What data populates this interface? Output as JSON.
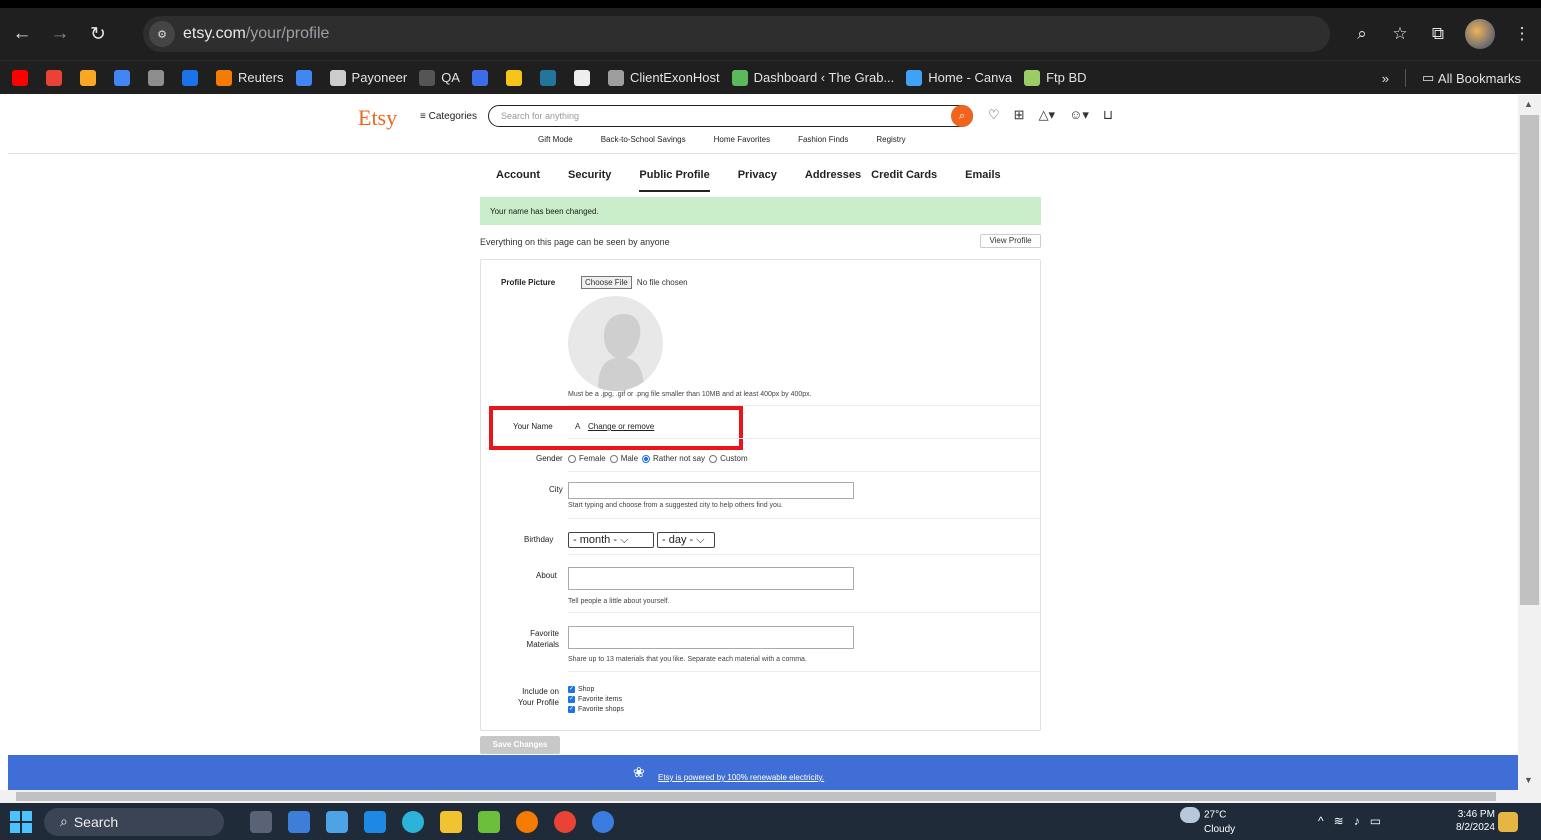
{
  "browser": {
    "url_host": "etsy.com",
    "url_path": "/your/profile",
    "bookmarks": [
      {
        "label": "",
        "color": "#ff0000"
      },
      {
        "label": "",
        "color": "#ea4335"
      },
      {
        "label": "",
        "color": "#f9a825"
      },
      {
        "label": "",
        "color": "#4285f4"
      },
      {
        "label": "",
        "color": "#8e8e8e"
      },
      {
        "label": "",
        "color": "#1a73e8"
      },
      {
        "label": "Reuters",
        "color": "#f57c00"
      },
      {
        "label": "",
        "color": "#4285f4"
      },
      {
        "label": "Payoneer",
        "color": "#cccccc"
      },
      {
        "label": "QA",
        "color": "#555555"
      },
      {
        "label": "",
        "color": "#3d6ce8"
      },
      {
        "label": "",
        "color": "#f5c518"
      },
      {
        "label": "",
        "color": "#21759b"
      },
      {
        "label": "",
        "color": "#eeeeee"
      },
      {
        "label": "ClientExonHost",
        "color": "#9e9e9e"
      },
      {
        "label": "Dashboard ‹ The Grab...",
        "color": "#5cb85c"
      },
      {
        "label": "Home - Canva",
        "color": "#3fa2f7"
      },
      {
        "label": "Ftp BD",
        "color": "#9ccc65"
      }
    ],
    "all_bookmarks": "All Bookmarks",
    "overflow": "»"
  },
  "etsy": {
    "logo": "Etsy",
    "categories": "≡ Categories",
    "search_placeholder": "Search for anything",
    "subnav": [
      "Gift Mode",
      "Back-to-School Savings",
      "Home Favorites",
      "Fashion Finds",
      "Registry"
    ],
    "tabs": [
      "Account",
      "Security",
      "Public Profile",
      "Privacy",
      "Addresses",
      "Credit Cards",
      "Emails"
    ],
    "active_tab": "Public Profile",
    "alert": "Your name has been changed.",
    "visible_note": "Everything on this page can be seen by anyone",
    "view_profile": "View Profile",
    "form": {
      "profile_picture_label": "Profile Picture",
      "choose_file_btn": "Choose File",
      "no_file": "No file chosen",
      "picture_hint": "Must be a .jpg, .gif or .png file smaller than 10MB and at least 400px by 400px.",
      "your_name_label": "Your Name",
      "your_name_value": "A",
      "change_link": "Change or remove",
      "gender_label": "Gender",
      "gender_options": [
        "Female",
        "Male",
        "Rather not say",
        "Custom"
      ],
      "gender_selected": "Rather not say",
      "city_label": "City",
      "city_value": "",
      "city_hint": "Start typing and choose from a suggested city to help others find you.",
      "birthday_label": "Birthday",
      "month_value": "- month -",
      "day_value": "- day -",
      "about_label": "About",
      "about_value": "",
      "about_hint": "Tell people a little about yourself.",
      "materials_label_1": "Favorite",
      "materials_label_2": "Materials",
      "materials_value": "",
      "materials_hint": "Share up to 13 materials that you like. Separate each material with a comma.",
      "include_label_1": "Include on",
      "include_label_2": "Your Profile",
      "include_options": [
        "Shop",
        "Favorite items",
        "Favorite shops"
      ],
      "save": "Save Changes"
    },
    "footer_note": "Etsy is powered by 100% renewable electricity."
  },
  "taskbar": {
    "search": "Search",
    "temperature": "27°C",
    "weather": "Cloudy",
    "time": "3:46 PM",
    "date": "8/2/2024"
  }
}
